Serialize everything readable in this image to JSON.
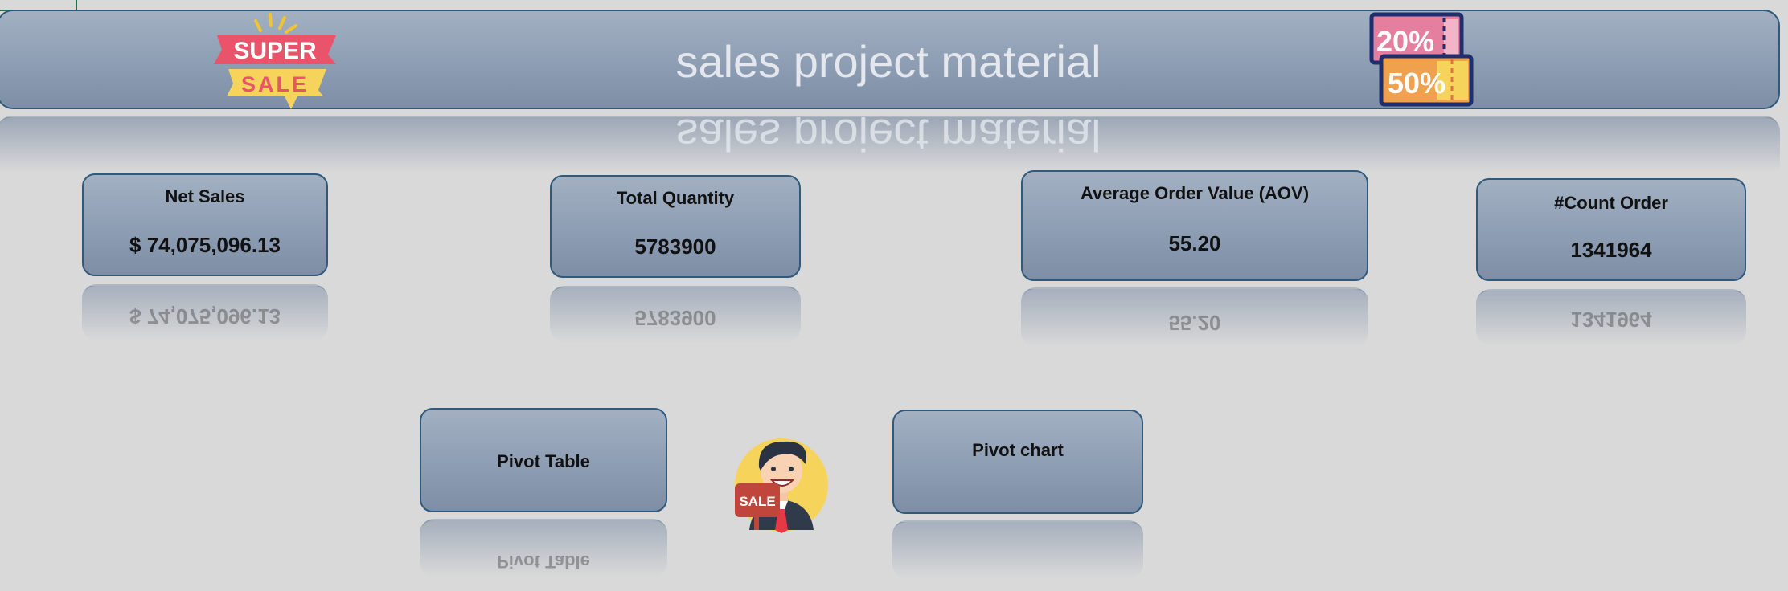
{
  "dashboard": {
    "title": "sales project material"
  },
  "kpis": [
    {
      "label": "Net Sales",
      "value": "$  74,075,096.13"
    },
    {
      "label": "Total Quantity",
      "value": "5783900"
    },
    {
      "label": "Average Order Value (AOV)",
      "value": "55.20"
    },
    {
      "label": "#Count Order",
      "value": "1341964"
    }
  ],
  "nav": {
    "pivot_table_label": "Pivot Table",
    "pivot_chart_label": "Pivot chart"
  },
  "logos": {
    "super_sale_top": "SUPER",
    "super_sale_bottom": "SALE",
    "discount_top": "20%",
    "discount_bottom": "50%",
    "salesman_sign": "SALE"
  },
  "colors": {
    "card_top": "#a2b0c2",
    "card_bottom": "#7d8ea6",
    "card_border": "#2f5a7c",
    "background": "#d9d9d9"
  }
}
